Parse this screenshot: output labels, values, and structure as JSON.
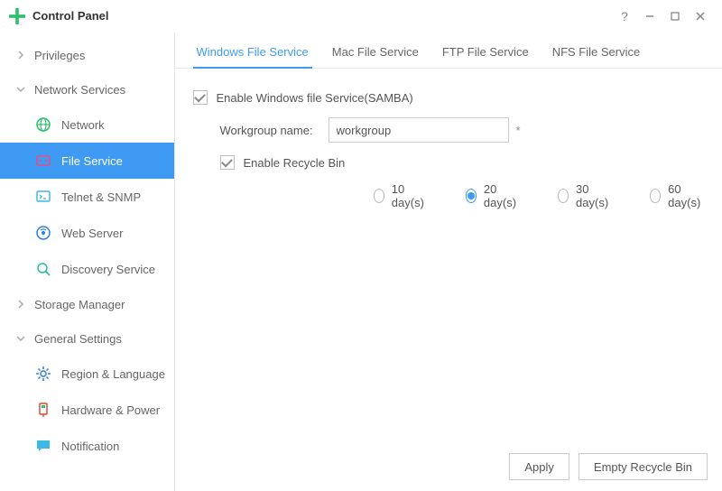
{
  "window": {
    "title": "Control Panel"
  },
  "sidebar": {
    "groups": [
      {
        "label": "Privileges",
        "expanded": false
      },
      {
        "label": "Network Services",
        "expanded": true
      },
      {
        "label": "Storage Manager",
        "expanded": false
      },
      {
        "label": "General Settings",
        "expanded": true
      }
    ],
    "network_items": [
      {
        "label": "Network"
      },
      {
        "label": "File Service"
      },
      {
        "label": "Telnet & SNMP"
      },
      {
        "label": "Web Server"
      },
      {
        "label": "Discovery Service"
      }
    ],
    "general_items": [
      {
        "label": "Region & Language"
      },
      {
        "label": "Hardware & Power"
      },
      {
        "label": "Notification"
      }
    ]
  },
  "tabs": [
    {
      "label": "Windows File Service"
    },
    {
      "label": "Mac File Service"
    },
    {
      "label": "FTP File Service"
    },
    {
      "label": "NFS File Service"
    }
  ],
  "form": {
    "enable_windows_label": "Enable Windows file Service(SAMBA)",
    "workgroup_label": "Workgroup name:",
    "workgroup_value": "workgroup",
    "workgroup_required": "*",
    "enable_recycle_label": "Enable Recycle Bin",
    "days_options": [
      {
        "label": "10 day(s)"
      },
      {
        "label": "20 day(s)"
      },
      {
        "label": "30 day(s)"
      },
      {
        "label": "60 day(s)"
      }
    ]
  },
  "buttons": {
    "apply": "Apply",
    "empty_bin": "Empty Recycle Bin"
  }
}
